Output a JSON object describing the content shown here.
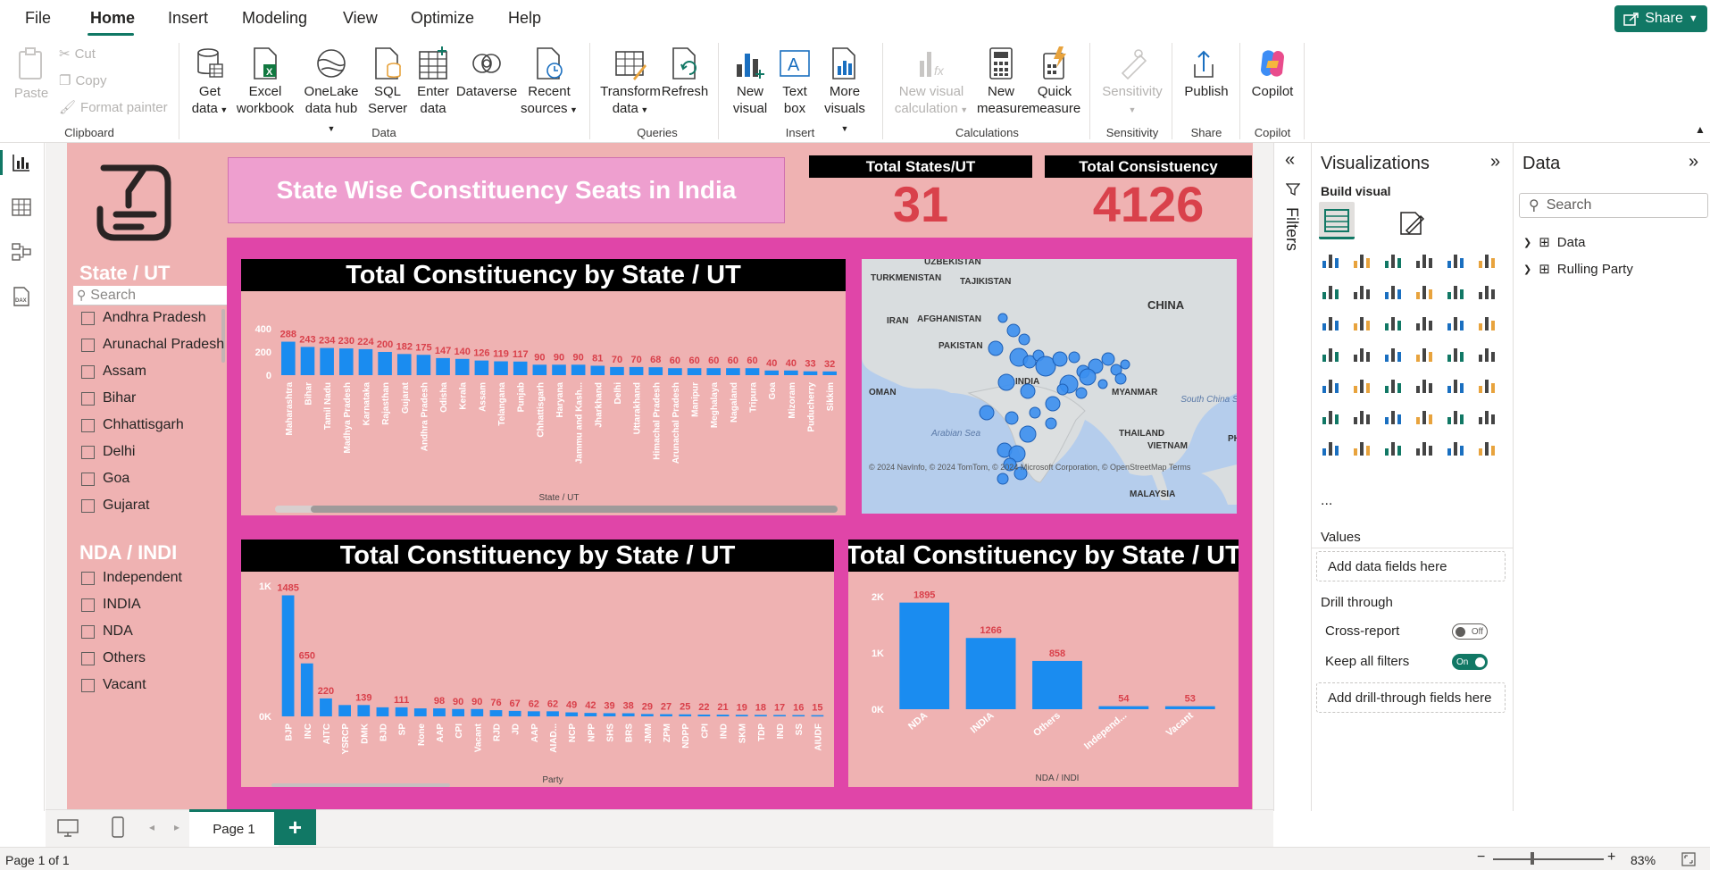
{
  "menu": {
    "items": [
      "File",
      "Home",
      "Insert",
      "Modeling",
      "View",
      "Optimize",
      "Help"
    ],
    "active": "Home",
    "share_label": "Share"
  },
  "ribbon": {
    "clipboard": {
      "paste": "Paste",
      "cut": "Cut",
      "copy": "Copy",
      "format_painter": "Format painter",
      "group": "Clipboard"
    },
    "data": {
      "get_data": [
        "Get",
        "data"
      ],
      "excel": [
        "Excel",
        "workbook"
      ],
      "onelake": [
        "OneLake",
        "data hub"
      ],
      "sql": [
        "SQL",
        "Server"
      ],
      "enter": [
        "Enter",
        "data"
      ],
      "dataverse": "Dataverse",
      "recent": [
        "Recent",
        "sources"
      ],
      "group": "Data"
    },
    "queries": {
      "transform": [
        "Transform",
        "data"
      ],
      "refresh": "Refresh",
      "group": "Queries"
    },
    "insert": {
      "new_visual": [
        "New",
        "visual"
      ],
      "text_box": [
        "Text",
        "box"
      ],
      "more_visuals": [
        "More",
        "visuals"
      ],
      "group": "Insert"
    },
    "calculations": {
      "new_visual_calc": [
        "New visual",
        "calculation"
      ],
      "new_measure": [
        "New",
        "measure"
      ],
      "quick_measure": [
        "Quick",
        "measure"
      ],
      "group": "Calculations"
    },
    "sensitivity": {
      "label": "Sensitivity",
      "group": "Sensitivity"
    },
    "share": {
      "publish": "Publish",
      "group": "Share"
    },
    "copilot": {
      "label": "Copilot",
      "group": "Copilot"
    }
  },
  "report": {
    "banner": "State Wise Constituency Seats in India",
    "kpi1": {
      "label": "Total States/UT",
      "value": "31"
    },
    "kpi2": {
      "label": "Total Consistuency",
      "value": "4126"
    },
    "slicer_state": {
      "title": "State / UT",
      "search_placeholder": "Search",
      "items": [
        "Andhra Pradesh",
        "Arunachal Pradesh",
        "Assam",
        "Bihar",
        "Chhattisgarh",
        "Delhi",
        "Goa",
        "Gujarat"
      ]
    },
    "slicer_alliance": {
      "title": "NDA / INDI",
      "items": [
        "Independent",
        "INDIA",
        "NDA",
        "Others",
        "Vacant"
      ]
    },
    "map": {
      "labels": [
        "UZBEKISTAN",
        "TURKMENISTAN",
        "TAJIKISTAN",
        "IRAN",
        "AFGHANISTAN",
        "CHINA",
        "PAKISTAN",
        "INDIA",
        "OMAN",
        "MYANMAR",
        "THAILAND",
        "VIETNAM",
        "South China Sea",
        "Arabian Sea",
        "MALAYSIA",
        "PH"
      ],
      "attribution": "© 2024 NavInfo, © 2024 TomTom, © 2024 Microsoft Corporation, © OpenStreetMap  Terms"
    }
  },
  "chart_data": [
    {
      "type": "bar",
      "title": "Total Constituency by State / UT",
      "xlabel": "State / UT",
      "ylabel": "",
      "y_ticks": [
        "400",
        "200",
        "0"
      ],
      "ylim": [
        0,
        400
      ],
      "categories": [
        "Maharashtra",
        "Bihar",
        "Tamil Nadu",
        "Madhya Pradesh",
        "Karnataka",
        "Rajasthan",
        "Gujarat",
        "Andhra Pradesh",
        "Odisha",
        "Kerala",
        "Assam",
        "Telangana",
        "Punjab",
        "Chhattisgarh",
        "Haryana",
        "Jammu and Kash...",
        "Jharkhand",
        "Delhi",
        "Uttarakhand",
        "Himachal Pradesh",
        "Arunachal Pradesh",
        "Manipur",
        "Meghalaya",
        "Nagaland",
        "Tripura",
        "Goa",
        "Mizoram",
        "Puducherry",
        "Sikkim"
      ],
      "values": [
        288,
        243,
        234,
        230,
        224,
        200,
        182,
        175,
        147,
        140,
        126,
        119,
        117,
        90,
        90,
        90,
        81,
        70,
        70,
        68,
        60,
        60,
        60,
        60,
        60,
        40,
        40,
        33,
        32
      ]
    },
    {
      "type": "bar",
      "title": "Total Constituency by State / UT",
      "xlabel": "Party",
      "ylabel": "",
      "y_ticks": [
        "1K",
        "0K"
      ],
      "ylim": [
        0,
        1600
      ],
      "categories": [
        "BJP",
        "INC",
        "AITC",
        "YSRCP",
        "DMK",
        "BJD",
        "SP",
        "None",
        "AAP",
        "CPI",
        "Vacant",
        "RJD",
        "JD",
        "AAP",
        "AIAD...",
        "NCP",
        "NPP",
        "SHS",
        "BRS",
        "JMM",
        "ZPM",
        "NDPP",
        "CPI",
        "IND",
        "SKM",
        "TDP",
        "IND",
        "SS",
        "AIUDF"
      ],
      "values": [
        1485,
        650,
        220,
        139,
        139,
        111,
        111,
        98,
        98,
        90,
        90,
        76,
        67,
        62,
        62,
        49,
        42,
        39,
        38,
        29,
        27,
        25,
        22,
        21,
        19,
        18,
        17,
        16,
        15
      ],
      "data_labels": [
        "1485",
        "650",
        "220",
        "",
        "139",
        "",
        "111",
        "",
        "98",
        "90",
        "90",
        "76",
        "67",
        "62",
        "62",
        "49",
        "42",
        "39",
        "38",
        "29",
        "27",
        "25",
        "22",
        "21",
        "19",
        "18",
        "17",
        "16",
        "15"
      ]
    },
    {
      "type": "bar",
      "title": "Total Constituency by State / UT",
      "xlabel": "NDA / INDI",
      "ylabel": "",
      "y_ticks": [
        "2K",
        "1K",
        "0K"
      ],
      "ylim": [
        0,
        2000
      ],
      "categories": [
        "NDA",
        "INDIA",
        "Others",
        "Independ...",
        "Vacant"
      ],
      "values": [
        1895,
        1266,
        858,
        54,
        53
      ]
    }
  ],
  "filters": {
    "label": "Filters"
  },
  "viz_pane": {
    "title": "Visualizations",
    "build_visual": "Build visual",
    "values_label": "Values",
    "values_placeholder": "Add data fields here",
    "drill_through": "Drill through",
    "cross_report": "Cross-report",
    "cross_report_state": "Off",
    "keep_all_filters": "Keep all filters",
    "keep_all_state": "On",
    "drill_placeholder": "Add drill-through fields here",
    "more": "..."
  },
  "data_pane": {
    "title": "Data",
    "search_placeholder": "Search",
    "tables": [
      "Data",
      "Rulling Party"
    ]
  },
  "pages": {
    "tab": "Page 1",
    "add": "+"
  },
  "status": {
    "page": "Page 1 of 1",
    "zoom": "83%"
  },
  "colors": {
    "accent": "#117865",
    "bar": "#1a8cf0",
    "report_bg": "#efb2b2",
    "frame": "#e045a8",
    "kpi": "#d9414b"
  }
}
